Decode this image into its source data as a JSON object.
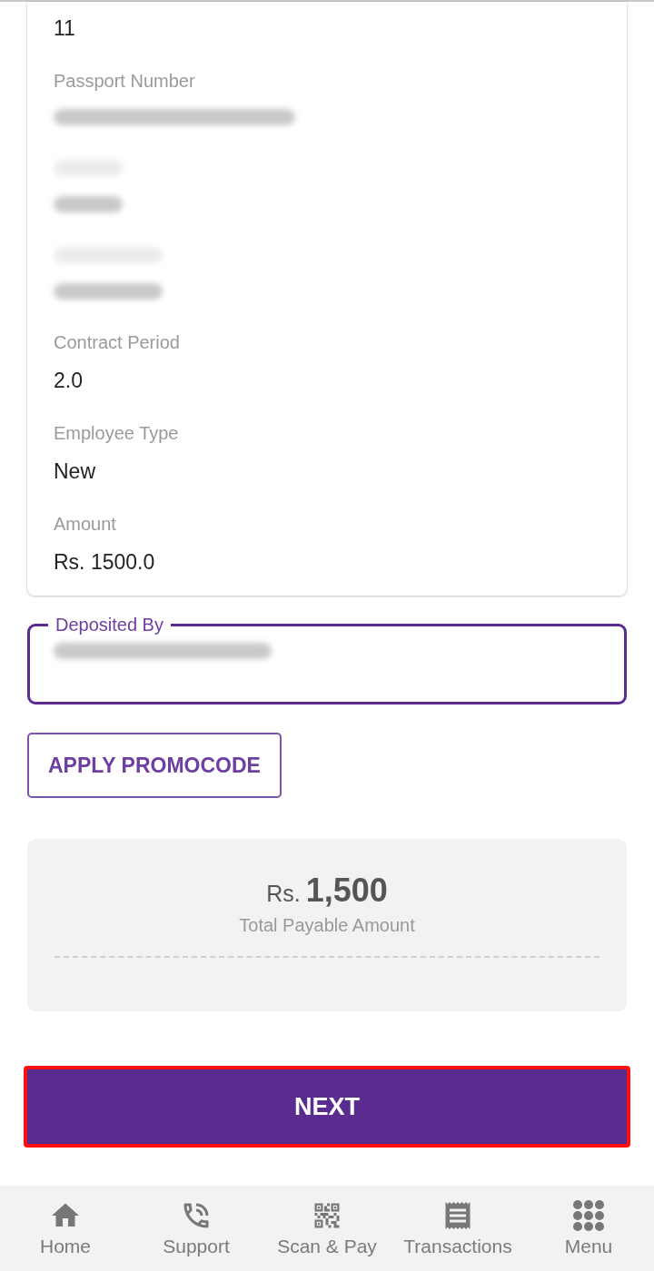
{
  "details": [
    {
      "label": {
        "kind": "hidden"
      },
      "value": {
        "kind": "text",
        "text": "11"
      }
    },
    {
      "label": {
        "kind": "text",
        "text": "Passport Number"
      },
      "value": {
        "kind": "redacted"
      }
    },
    {
      "label": {
        "kind": "redacted"
      },
      "value": {
        "kind": "redacted"
      }
    },
    {
      "label": {
        "kind": "redacted"
      },
      "value": {
        "kind": "redacted"
      }
    },
    {
      "label": {
        "kind": "text",
        "text": "Contract Period"
      },
      "value": {
        "kind": "text",
        "text": "2.0"
      }
    },
    {
      "label": {
        "kind": "text",
        "text": "Employee Type"
      },
      "value": {
        "kind": "text",
        "text": "New"
      }
    },
    {
      "label": {
        "kind": "text",
        "text": "Amount"
      },
      "value": {
        "kind": "text",
        "text": "Rs. 1500.0"
      }
    }
  ],
  "deposited_by": {
    "label": "Deposited By",
    "value": {
      "kind": "redacted"
    }
  },
  "promo_button": "APPLY PROMOCODE",
  "total": {
    "currency": "Rs.",
    "amount": "1,500",
    "caption": "Total Payable Amount"
  },
  "next_button": {
    "label": "NEXT",
    "highlighted": true
  },
  "nav": [
    {
      "kind": "home",
      "label": "Home"
    },
    {
      "kind": "support",
      "label": "Support"
    },
    {
      "kind": "scan",
      "label": "Scan & Pay"
    },
    {
      "kind": "transactions",
      "label": "Transactions"
    },
    {
      "kind": "menu",
      "label": "Menu"
    }
  ]
}
